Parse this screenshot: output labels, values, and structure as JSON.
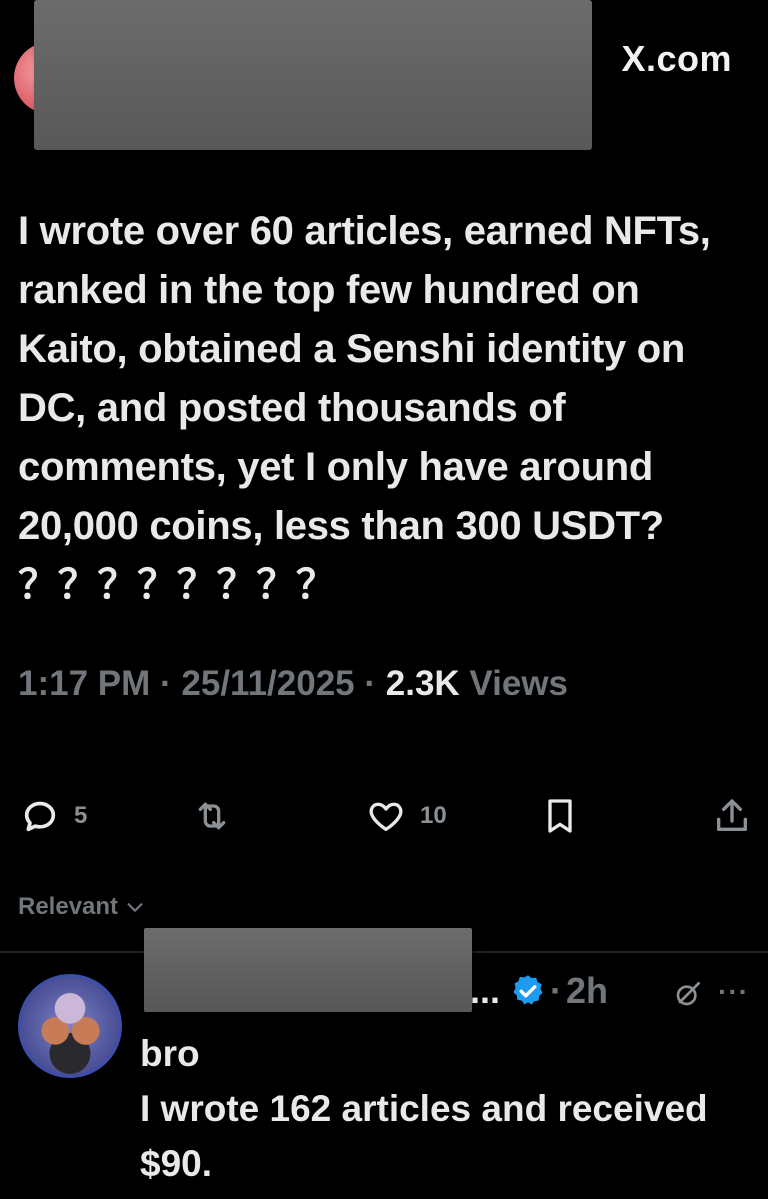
{
  "header": {
    "site": "X.com"
  },
  "tweet": {
    "text": "I wrote over 60 articles, earned NFTs, ranked in the top few hundred on Kaito, obtained a Senshi identity on DC, and posted thousands of comments, yet I only have around 20,000 coins, less than 300 USDT? ？？？？？？？？",
    "time": "1:17 PM",
    "sep1": " · ",
    "date": "25/11/2025",
    "sep2": " · ",
    "views_count": "2.3K",
    "views_label": " Views"
  },
  "actions": {
    "replies": "5",
    "reposts": "",
    "likes": "10"
  },
  "sort": {
    "label": "Relevant"
  },
  "reply": {
    "name_truncation": "...",
    "separator": "·",
    "time": "2h",
    "more": "···",
    "text": "bro\nI wrote 162 articles and received $90."
  },
  "colors": {
    "background": "#000000",
    "text": "#e7e9ea",
    "muted": "#71767b",
    "verified": "#1d9bf0"
  },
  "icons": [
    "reply-icon",
    "repost-icon",
    "like-icon",
    "bookmark-icon",
    "share-icon",
    "chevron-down-icon",
    "verified-icon",
    "grok-icon",
    "more-icon"
  ]
}
